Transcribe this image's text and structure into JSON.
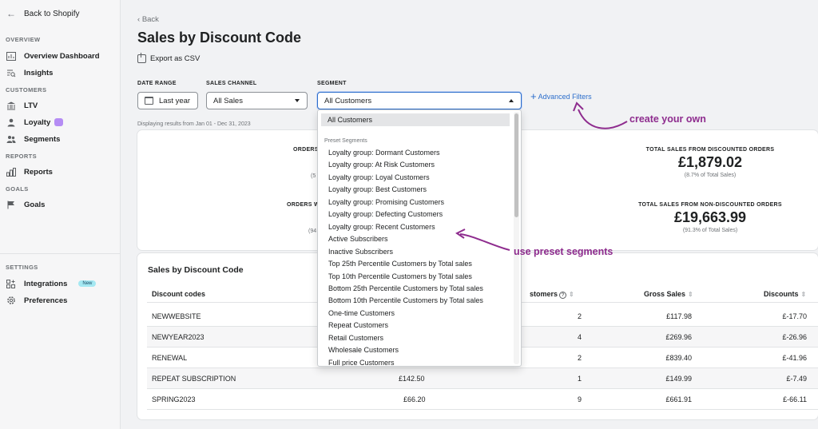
{
  "sidebar": {
    "back": "Back to Shopify",
    "sections": {
      "overview": "OVERVIEW",
      "customers": "CUSTOMERS",
      "reports": "REPORTS",
      "goals": "GOALS",
      "settings": "SETTINGS"
    },
    "items": {
      "overview_dashboard": "Overview Dashboard",
      "insights": "Insights",
      "ltv": "LTV",
      "loyalty": "Loyalty",
      "segments": "Segments",
      "reports": "Reports",
      "goals": "Goals",
      "integrations": "Integrations",
      "integrations_badge": "New",
      "preferences": "Preferences"
    }
  },
  "header": {
    "back": "Back",
    "title": "Sales by Discount Code",
    "export": "Export as CSV"
  },
  "filters": {
    "date_range_label": "DATE RANGE",
    "date_range_value": "Last year",
    "sales_channel_label": "SALES CHANNEL",
    "sales_channel_value": "All Sales",
    "segment_label": "SEGMENT",
    "segment_value": "All Customers",
    "advanced": "Advanced Filters"
  },
  "display_range": "Displaying results from Jan 01 - Dec 31, 2023",
  "metrics": {
    "orders_label_partial": "ORDERS",
    "orders_sub_partial": "(5",
    "orders_w_label_partial": "ORDERS W",
    "orders_w_sub_partial": "(94",
    "discounted_label": "TOTAL SALES FROM DISCOUNTED ORDERS",
    "discounted_value": "£1,879.02",
    "discounted_sub": "(8.7% of Total Sales)",
    "non_discounted_label": "TOTAL SALES FROM NON-DISCOUNTED ORDERS",
    "non_discounted_value": "£19,663.99",
    "non_discounted_sub": "(91.3% of Total Sales)"
  },
  "table": {
    "title": "Sales by Discount Code",
    "headers": {
      "code": "Discount codes",
      "customers": "stomers",
      "gross": "Gross Sales",
      "discounts": "Discounts"
    },
    "rows": [
      {
        "code": "NEWWEBSITE",
        "net": "",
        "customers": "2",
        "gross": "£117.98",
        "discounts": "£-17.70"
      },
      {
        "code": "NEWYEAR2023",
        "net": "",
        "customers": "4",
        "gross": "£269.96",
        "discounts": "£-26.96"
      },
      {
        "code": "RENEWAL",
        "net": "",
        "customers": "2",
        "gross": "£839.40",
        "discounts": "£-41.96"
      },
      {
        "code": "REPEAT SUBSCRIPTION",
        "net": "£142.50",
        "customers": "1",
        "gross": "£149.99",
        "discounts": "£-7.49"
      },
      {
        "code": "SPRING2023",
        "net": "£66.20",
        "customers": "9",
        "gross": "£661.91",
        "discounts": "£-66.11"
      }
    ]
  },
  "dropdown": {
    "selected": "All Customers",
    "group": "Preset Segments",
    "options": [
      "Loyalty group: Dormant Customers",
      "Loyalty group: At Risk Customers",
      "Loyalty group: Loyal Customers",
      "Loyalty group: Best Customers",
      "Loyalty group: Promising Customers",
      "Loyalty group: Defecting Customers",
      "Loyalty group: Recent Customers",
      "Active Subscribers",
      "Inactive Subscribers",
      "Top 25th Percentile Customers by Total sales",
      "Top 10th Percentile Customers by Total sales",
      "Bottom 25th Percentile Customers by Total sales",
      "Bottom 10th Percentile Customers by Total sales",
      "One-time Customers",
      "Repeat Customers",
      "Retail Customers",
      "Wholesale Customers",
      "Full price Customers"
    ]
  },
  "annotations": {
    "create": "create your own",
    "preset": "use preset segments"
  },
  "colors": {
    "accent": "#2c6ecb",
    "annotation": "#8e2c8e"
  }
}
